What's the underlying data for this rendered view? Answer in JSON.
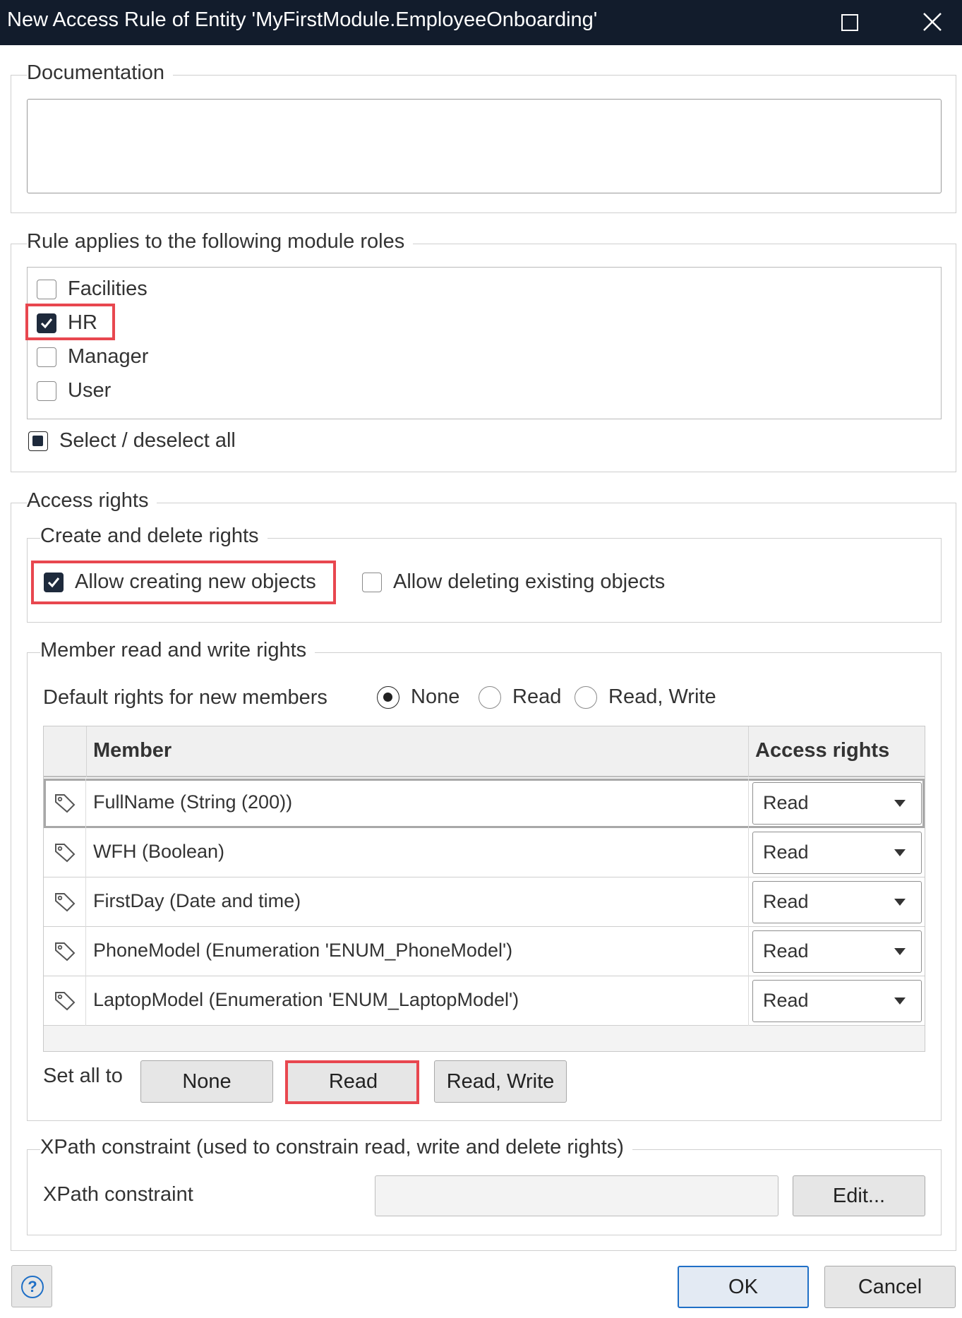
{
  "window": {
    "title": "New Access Rule of Entity 'MyFirstModule.EmployeeOnboarding'"
  },
  "documentation": {
    "legend": "Documentation",
    "value": ""
  },
  "roles": {
    "legend": "Rule applies to the following module roles",
    "items": [
      {
        "label": "Facilities",
        "checked": false
      },
      {
        "label": "HR",
        "checked": true
      },
      {
        "label": "Manager",
        "checked": false
      },
      {
        "label": "User",
        "checked": false
      }
    ],
    "select_all_label": "Select / deselect all"
  },
  "access": {
    "legend": "Access rights",
    "create_delete": {
      "legend": "Create and delete rights",
      "allow_create_label": "Allow creating new objects",
      "allow_create_checked": true,
      "allow_delete_label": "Allow deleting existing objects",
      "allow_delete_checked": false
    },
    "member_rights": {
      "legend": "Member read and write rights",
      "default_label": "Default rights for new members",
      "default_options": [
        "None",
        "Read",
        "Read, Write"
      ],
      "default_selected": "None",
      "table": {
        "columns": [
          "Member",
          "Access rights"
        ],
        "rows": [
          {
            "member": "FullName (String (200))",
            "rights": "Read",
            "icon": "tag-icon"
          },
          {
            "member": "WFH (Boolean)",
            "rights": "Read",
            "icon": "tag-icon"
          },
          {
            "member": "FirstDay (Date and time)",
            "rights": "Read",
            "icon": "tag-icon"
          },
          {
            "member": "PhoneModel (Enumeration 'ENUM_PhoneModel')",
            "rights": "Read",
            "icon": "tag-icon"
          },
          {
            "member": "LaptopModel (Enumeration 'ENUM_LaptopModel')",
            "rights": "Read",
            "icon": "tag-icon"
          }
        ]
      },
      "set_all_label": "Set all to",
      "set_all_buttons": [
        "None",
        "Read",
        "Read, Write"
      ]
    },
    "xpath": {
      "legend": "XPath constraint (used to constrain read, write and delete rights)",
      "label": "XPath constraint",
      "value": "",
      "edit_label": "Edit..."
    }
  },
  "footer": {
    "ok_label": "OK",
    "cancel_label": "Cancel",
    "help_symbol": "?"
  },
  "colors": {
    "titlebar": "#121c2c",
    "highlight": "#e8474f",
    "primary_border": "#1f6fc6"
  }
}
